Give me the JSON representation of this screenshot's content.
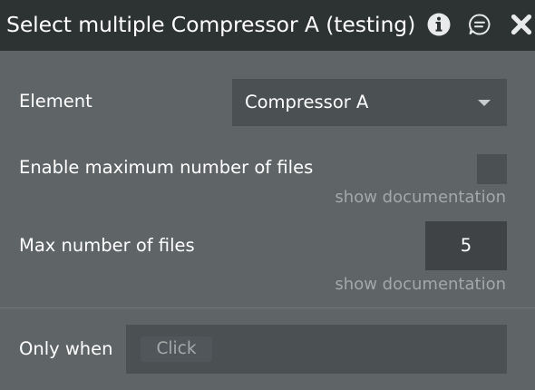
{
  "header": {
    "title": "Select multiple Compressor A (testing)",
    "icons": [
      "info-icon",
      "comment-icon",
      "close-icon"
    ]
  },
  "fields": {
    "element": {
      "label": "Element",
      "selected_value": "Compressor A"
    },
    "enable_max": {
      "label": "Enable maximum number of files",
      "checked": false,
      "doc_link": "show documentation"
    },
    "max_files": {
      "label": "Max number of files",
      "value": "5",
      "doc_link": "show documentation"
    },
    "only_when": {
      "label": "Only when",
      "placeholder": "Click"
    }
  },
  "colors": {
    "header_bg": "#2d3233",
    "panel_bg": "#5f6466",
    "field_bg": "#4b5052",
    "muted_text": "#a4a8a9"
  }
}
